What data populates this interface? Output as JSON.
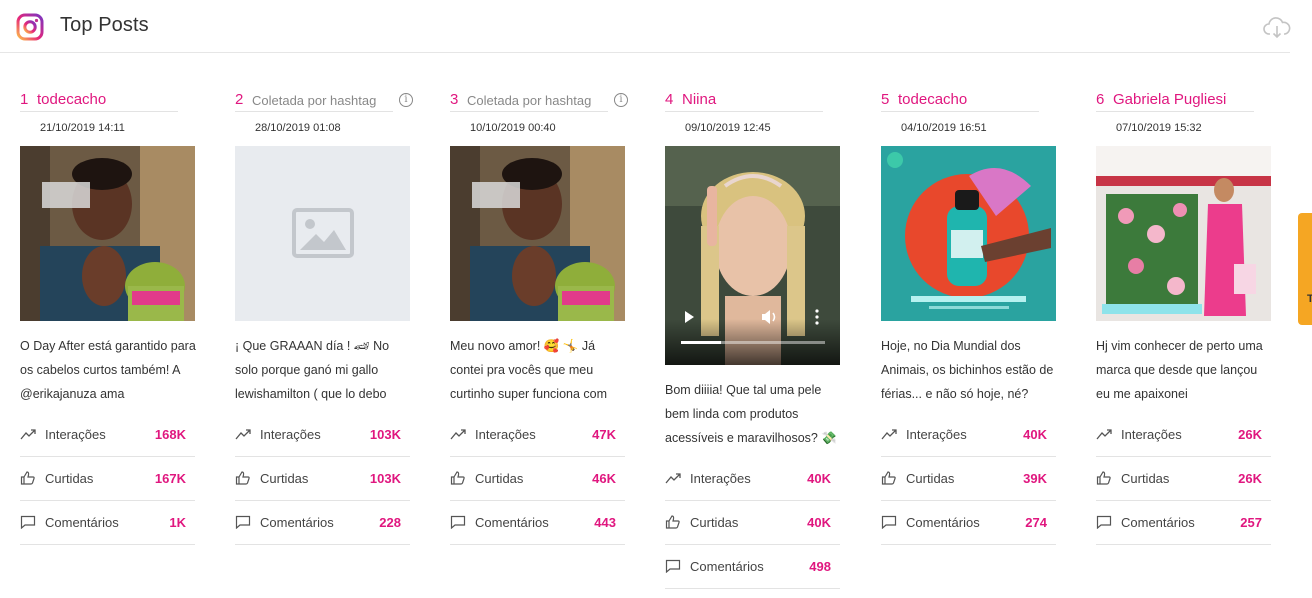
{
  "header": {
    "title": "Top Posts"
  },
  "icons": {
    "logo": "instagram-icon",
    "download": "cloud-download-icon",
    "interactions": "trending-up-icon",
    "likes": "thumbs-up-icon",
    "comments": "comment-icon",
    "info": "info-icon",
    "placeholder": "image-placeholder-icon"
  },
  "colors": {
    "accent": "#e0177f",
    "side_tab": "#f5a623"
  },
  "metric_labels": {
    "interactions": "Interações",
    "likes": "Curtidas",
    "comments": "Comentários"
  },
  "side_tab": {
    "glyph": "T"
  },
  "posts": [
    {
      "rank": "1",
      "author": "todecacho",
      "date": "21/10/2019 14:11",
      "caption": "O Day After está garantido para os cabelos curtos também! A @erikajanuza ama",
      "interactions": "168K",
      "likes": "167K",
      "comments": "1K"
    },
    {
      "rank": "2",
      "author": "Coletada por hashtag",
      "date": "28/10/2019 01:08",
      "caption": "¡ Que GRAAAN día ! 🏎 No solo porque ganó mi gallo lewishamilton ( que lo debo",
      "interactions": "103K",
      "likes": "103K",
      "comments": "228",
      "info": "i"
    },
    {
      "rank": "3",
      "author": "Coletada por hashtag",
      "date": "10/10/2019 00:40",
      "caption": "Meu novo amor! 🥰 🤸 Já contei pra vocês que meu curtinho super funciona com",
      "interactions": "47K",
      "likes": "46K",
      "comments": "443",
      "info": "i"
    },
    {
      "rank": "4",
      "author": "Niina",
      "date": "09/10/2019 12:45",
      "caption": "Bom diiiia! Que tal uma pele bem linda com produtos acessíveis e maravilhosos? 💸",
      "interactions": "40K",
      "likes": "40K",
      "comments": "498",
      "video_progress": 0.28
    },
    {
      "rank": "5",
      "author": "todecacho",
      "date": "04/10/2019 16:51",
      "caption": "Hoje, no Dia Mundial dos Animais, os bichinhos estão de férias... e não só hoje, né?",
      "interactions": "40K",
      "likes": "39K",
      "comments": "274"
    },
    {
      "rank": "6",
      "author": "Gabriela Pugliesi",
      "date": "07/10/2019 15:32",
      "caption": "Hj vim conhecer de perto uma marca que desde que lançou eu me apaixonei",
      "interactions": "26K",
      "likes": "26K",
      "comments": "257"
    }
  ]
}
